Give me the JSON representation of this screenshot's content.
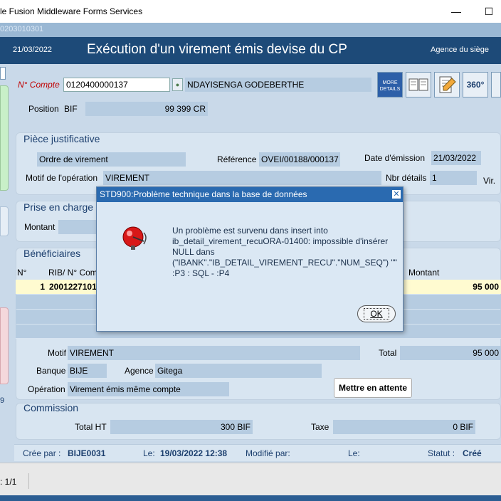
{
  "window": {
    "title": "le Fusion Middleware Forms Services",
    "min_icon": "—",
    "max_icon": "☐"
  },
  "session": {
    "code": "0203010301"
  },
  "header": {
    "date": "21/03/2022",
    "title": "Exécution d'un virement émis devise du CP",
    "agence": "Agence du siège"
  },
  "account": {
    "label": "N° Compte",
    "number": "0120400000137",
    "holder": "NDAYISENGA GODEBERTHE",
    "position_label": "Position",
    "position_currency": "BIF",
    "position_value": "99 399 CR"
  },
  "toolbar": {
    "more_details": "MORE DETAILS",
    "view360": "360°"
  },
  "piece": {
    "section": "Pièce justificative",
    "type_value": "Ordre de virement",
    "reference_label": "Référence",
    "reference_value": "OVEI/00188/000137",
    "date_label": "Date d'émission",
    "date_value": "21/03/2022",
    "motif_label": "Motif de l'opération",
    "motif_value": "VIREMENT",
    "nbr_label": "Nbr détails",
    "nbr_value": "1",
    "vir_label": "Vir."
  },
  "prise": {
    "section": "Prise en charge",
    "montant_label": "Montant"
  },
  "benef": {
    "section": "Bénéficiaires",
    "col_no": "N°",
    "col_rib": "RIB/ N° Compte",
    "col_montant": "Montant",
    "rows": [
      {
        "no": "1",
        "rib": "20012271011",
        "montant": "95 000"
      }
    ],
    "motif_label": "Motif",
    "motif_value": "VIREMENT",
    "total_label": "Total",
    "total_value": "95 000",
    "banque_label": "Banque",
    "banque_value": "BIJE",
    "agence_label": "Agence",
    "agence_value": "Gitega",
    "operation_label": "Opération",
    "operation_value": "Virement émis même compte",
    "attente_button": "Mettre en attente"
  },
  "commission": {
    "section": "Commission",
    "total_ht_label": "Total HT",
    "total_ht_value": "300 BIF",
    "taxe_label": "Taxe",
    "taxe_value": "0 BIF"
  },
  "footer": {
    "cree_par_label": "Crée par :",
    "cree_par_value": "BIJE0031",
    "le_label": "Le:",
    "le_value": "19/03/2022 12:38",
    "modifie_label": "Modifié par:",
    "le2_label": "Le:",
    "statut_label": "Statut :",
    "statut_value": "Créé"
  },
  "status": {
    "record": ": 1/1",
    "left_digit": "9"
  },
  "dialog": {
    "title": "STD900:Problème technique dans la base de données",
    "close_icon": "✕",
    "message": "Un problème est survenu dans insert into ib_detail_virement_recuORA-01400: impossible d'insérer NULL dans (\"IBANK\".\"IB_DETAIL_VIREMENT_RECU\".\"NUM_SEQ\") \"\" :P3 : SQL - :P4",
    "ok_label": "OK",
    "icon": "alarm-bell-icon"
  }
}
